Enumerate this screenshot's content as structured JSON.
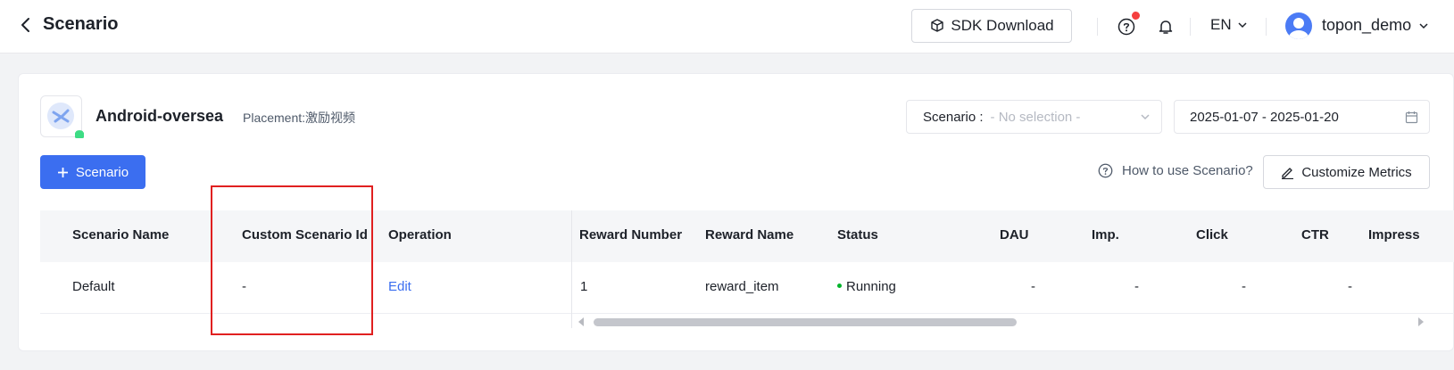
{
  "header": {
    "title": "Scenario",
    "sdk_download_label": "SDK Download",
    "language": "EN",
    "username": "topon_demo"
  },
  "app": {
    "name": "Android-oversea",
    "placement": "Placement:激励视频"
  },
  "filters": {
    "scenario_label": "Scenario :",
    "scenario_placeholder": "- No selection -",
    "date_range": "2025-01-07 - 2025-01-20"
  },
  "actions": {
    "add_scenario_label": "Scenario",
    "how_to_label": "How to use Scenario?",
    "customize_metrics_label": "Customize Metrics"
  },
  "table": {
    "columns": [
      "Scenario Name",
      "Custom Scenario Id",
      "Operation",
      "Reward Number",
      "Reward Name",
      "Status",
      "DAU",
      "Imp.",
      "Click",
      "CTR",
      "Impress"
    ],
    "rows": [
      {
        "scenario_name": "Default",
        "custom_id": "-",
        "operation": "Edit",
        "reward_number": "1",
        "reward_name": "reward_item",
        "status": "Running",
        "dau": "-",
        "imp": "-",
        "click": "-",
        "ctr": "-"
      }
    ]
  },
  "colors": {
    "primary": "#3b6ef0",
    "status_running": "#00b42a",
    "highlight": "#e02020",
    "notification": "#f53f3f"
  }
}
